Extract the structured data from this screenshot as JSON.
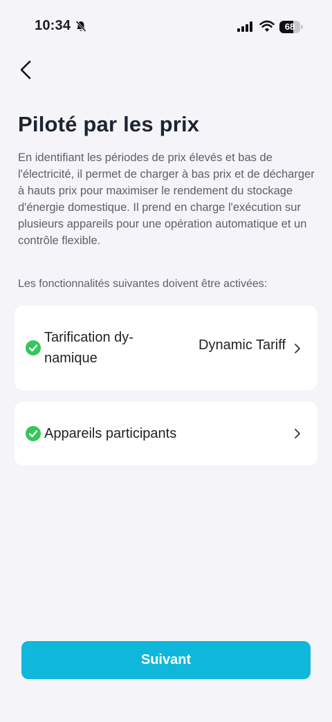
{
  "status_bar": {
    "time": "10:34",
    "battery": "68",
    "battery_level": 0.68
  },
  "page": {
    "title": "Piloté par les prix",
    "description": "En identifiant les périodes de prix élevés et bas de l'électricité, il permet de charger à bas prix et de dé­charger à hauts prix pour maximiser le rendement du stockage d'énergie domestique. Il prend en charge l'exécution sur plusieurs appareils pour une opération automatique et un contrôle flexible.",
    "requirements_label": "Les fonctionnalités suivantes doivent être activées:"
  },
  "features": [
    {
      "label": "Tarification dy­namique",
      "value": "Dynamic Tariff",
      "status": "enabled"
    },
    {
      "label": "Appareils participants",
      "value": "",
      "status": "enabled"
    }
  ],
  "next_button": {
    "label": "Suivant"
  },
  "colors": {
    "accent": "#0fb8db",
    "check": "#34c759",
    "background": "#f5f4f9"
  }
}
